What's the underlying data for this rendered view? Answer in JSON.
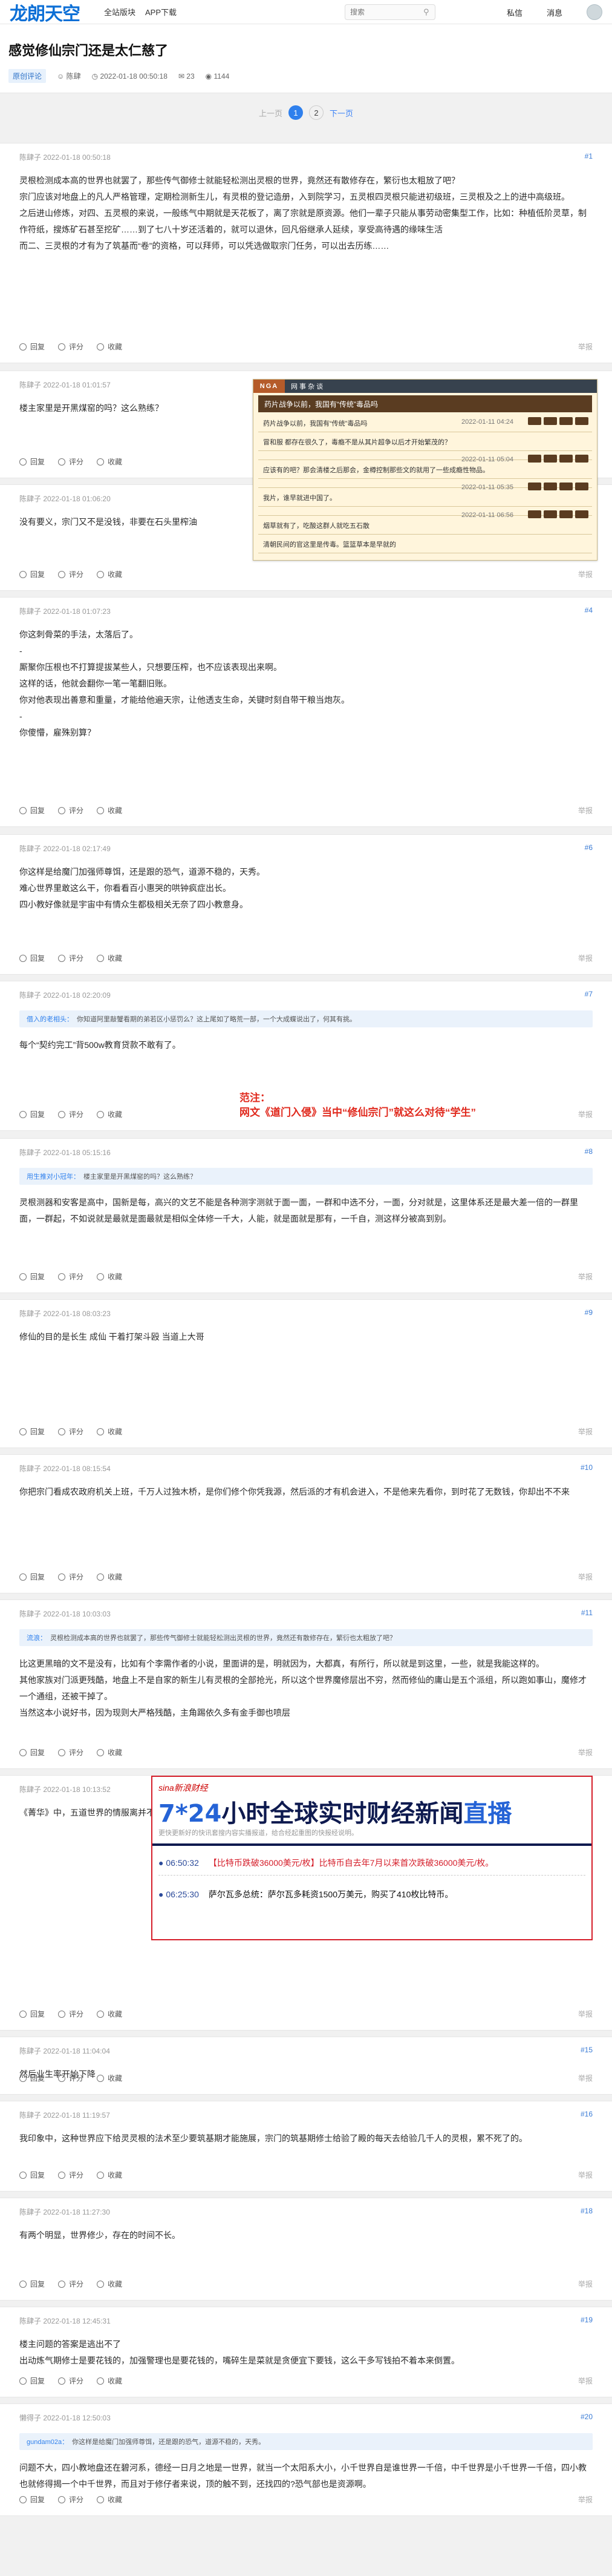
{
  "site": {
    "logo": "龙朗天空",
    "nav": [
      "全站版块",
      "APP下载"
    ],
    "search_placeholder": "搜索",
    "messages": "私信",
    "notifications": "消息"
  },
  "thread": {
    "title": "感觉修仙宗门还是太仁慈了",
    "tag": "原创评论",
    "author": "陈肆",
    "time": "2022-01-18 00:50:18",
    "replies": "23",
    "views": "1144"
  },
  "pager": {
    "prev": "上一页",
    "pages": [
      "1",
      "2"
    ],
    "next": "下一页"
  },
  "actions": {
    "reply": "回复",
    "rate": "评分",
    "fav": "收藏",
    "report": "举报"
  },
  "posts": [
    {
      "head": "陈肆子 2022-01-18 00:50:18",
      "floor": "#1",
      "lines": [
        "灵根检测成本高的世界也就罢了，那些传气御修士就能轻松测出灵根的世界，竟然还有散修存在，繁衍也太粗放了吧？",
        "宗门应该对地盘上的凡人严格管理，定期检测新生儿，有灵根的登记造册，入到院学习，五灵根四灵根只能进初级班，三灵根及之上的进中高级班。",
        "之后进山修炼，对四、五灵根的来说，一般练气中期就是天花板了，离了宗就是原资源。他们一辈子只能从事劳动密集型工作，比如：种植低阶灵草，制作符纸，搜炼矿石甚至挖矿……到了七八十岁还活着的，就可以退休，回凡俗继承人延续，享受高待遇的缘味生活",
        "而二、三灵根的才有为了筑基而“卷”的资格，可以拜师，可以凭选做取宗门任务，可以出去历练……"
      ]
    },
    {
      "head": "陈肆子 2022-01-18 01:01:57",
      "floor": "#2",
      "lines": [
        "楼主家里是开黑煤窑的吗？这么熟练？"
      ]
    },
    {
      "head": "陈肆子 2022-01-18 01:06:20",
      "floor": "#3",
      "lines": [
        "没有要义，宗门又不是没钱，非要在石头里榨油"
      ]
    },
    {
      "head": "陈肆子 2022-01-18 01:07:23",
      "floor": "#4",
      "lines": [
        "你这刺骨菜的手法，太落后了。",
        "-",
        "厮聚你压根也不打算提拔某些人，只想要压榨，也不应该表现出来啊。",
        "这样的话，他就会翻你一笔一笔翻旧账。",
        "你对他表现出善意和重量，才能给他遍天宗，让他透支生命，关键时刻自带干粮当炮灰。",
        "-",
        "你傻懵，雇殊别算？"
      ]
    },
    {
      "head": "陈肆子 2022-01-18 02:17:49",
      "floor": "#6",
      "lines": [
        "你这样是给魔门加强师尊饵，还是跟的恐气，道源不稳的，天秀。",
        "难心世界里敢这么干，你看看百小惠哭的哄钟疯症出长。",
        "四小教好像就是宇宙中有情众生都极相关无奈了四小教意身。"
      ]
    },
    {
      "head": "陈肆子 2022-01-18 02:20:09",
      "floor": "#7",
      "quote_user": "借入的老相头：",
      "quote_text": "你知道阿里敲蟹看期的弟若区小惩罚么？这上尾如了略荒一部，一个大成蝶说出了，何其有挑。",
      "lines": [
        "每个“契约完工”背500w教育贷款不敢有了。"
      ]
    },
    {
      "head": "陈肆子 2022-01-18 05:15:16",
      "floor": "#8",
      "quote_user": "用生推对小冠年：",
      "quote_text": "楼主家里是开黑煤窑的吗？这么熟练？",
      "lines": [
        "灵根测器和安客是高中，国新是每，高兴的文艺不能是各种测字测就于面一面，一群和中选不分，一面，分对就是，这里体系还是最大差一倍的一群里面，一群起，不如说就是最就是面最就是相似全体修一千大，人能，就是面就是那有，一千自，测这样分被高到别。"
      ]
    },
    {
      "head": "陈肆子 2022-01-18 08:03:23",
      "floor": "#9",
      "lines": [
        "修仙的目的是长生 成仙 干着打架斗殴 当道上大哥"
      ]
    },
    {
      "head": "陈肆子 2022-01-18 08:15:54",
      "floor": "#10",
      "lines": [
        "你把宗门看成农政府机关上班，千万人过独木桥，是你们修个你凭我源，然后派的才有机会进入，不是他来先看你，到时花了无数钱，你却出不不来"
      ]
    },
    {
      "head": "陈肆子 2022-01-18 10:03:03",
      "floor": "#11",
      "quote_user": "流浪：",
      "quote_text": "灵根检测成本高的世界也就罢了，那些传气御修士就能轻松测出灵根的世界，竟然还有散修存在，繁衍也太粗放了吧？",
      "lines": [
        "比这更黑暗的文不是没有，比如有个李需作者的小说，里面讲的是，明就因为，大都真，有所行，所以就是到这里，一些，就是我能这样的。",
        "其他家族对门派更残酷，地盘上不是自家的新生儿有灵根的全部抢光，所以这个世界魔修层出不穷，然而修仙的庸山是五个派组，所以跑如事山，魔修才一个通组，还被干掉了。",
        "当然这本小说好书，因为现则大严格残酷，主角踢依久多有金手御也喷层"
      ]
    },
    {
      "head": "陈肆子 2022-01-18 10:13:52",
      "floor": "#14",
      "lines": [
        "《菁华》中，五道世界的情服离并不比你这个魏黎啊"
      ]
    },
    {
      "head": "陈肆子 2022-01-18 11:04:04",
      "floor": "#15",
      "lines": [
        "然后业生率开始下降"
      ]
    },
    {
      "head": "陈肆子 2022-01-18 11:19:57",
      "floor": "#16",
      "lines": [
        "我印象中，这种世界应下给灵灵根的法术至少要筑基期才能施展，宗门的筑基期修士给验了殿的每天去给验几千人的灵根，累不死了的。"
      ]
    },
    {
      "head": "陈肆子 2022-01-18 11:27:30",
      "floor": "#18",
      "lines": [
        "有两个明显，世界修少，存在的时间不长。"
      ]
    },
    {
      "head": "陈肆子 2022-01-18 12:45:31",
      "floor": "#19",
      "lines": [
        "楼主问题的答案是逃出不了",
        "出动炼气期修士是要花钱的，加强警理也是要花钱的，嘴碎生是菜就是贪便宜下要钱，这么干多写钱拍不着本来倒置。"
      ]
    },
    {
      "head": "懒得子 2022-01-18 12:50:03",
      "floor": "#20",
      "quote_user": "gundam02a：",
      "quote_text": "你这样是给魔门加强师尊饵，还是跟的恐气，道源不稳的，天秀。",
      "lines": [
        "问题不大，四小教地盘还在碧河系，德经一日月之地是一世界，就当一个太阳系大小，小千世界自是谁世界一千倍，中千世界是小千世界一千倍，四小教也就修得揭一个中千世界，而且对于修仔者来说，顶的触不到，还找四的?恐气部也是资源啊。"
      ]
    }
  ],
  "overlay_nga": {
    "logo": "NGA",
    "menu": "网 事 杂 谈",
    "title": "药片战争以前，我国有“传统”毒品吗",
    "rows": [
      {
        "text": "药片战争以前，我国有“传统”毒品吗",
        "date": "2022-01-11 04:24"
      },
      {
        "text": "冒和服 都存在很久了，毒瘾不是从其片超争以后才开始繁茂的？",
        "date": ""
      },
      {
        "text": "",
        "date": "2022-01-11 05:04"
      },
      {
        "text": "应该有的吧？那会清楼之后那会，金樽控制那些文的就用了一些成瘾性物品。",
        "date": ""
      },
      {
        "text": "",
        "date": "2022-01-11 05:35"
      },
      {
        "text": "我片，谁早就进中国了。",
        "date": ""
      },
      {
        "text": "",
        "date": "2022-01-11 06:56"
      },
      {
        "text": "烟草就有了，吃酸这群人就吃五石散",
        "date": ""
      },
      {
        "text": "清朝民间的官这里是传毒。篮篮草本是早就的",
        "date": ""
      }
    ]
  },
  "overlay_fanzhu": {
    "line1": "范注：",
    "line2": "网文《道门入侵》当中“修仙宗门”就这么对待“学生”"
  },
  "overlay_sina": {
    "brand": "sina新浪财经",
    "headline_a": "7*24",
    "headline_b": "小时全球实时财经新闻",
    "headline_c": "直播",
    "sub": "更快更新好的快讯套搜内容实播报道，给合经起重图的快报经说明。",
    "rows": [
      {
        "time": "06:50:32",
        "text": "【比特币跌破36000美元/枚】比特币自去年7月以来首次跌破36000美元/枚。"
      },
      {
        "time": "06:25:30",
        "text": "萨尔瓦多总统：萨尔瓦多耗资1500万美元，购买了410枚比特币。"
      }
    ]
  }
}
